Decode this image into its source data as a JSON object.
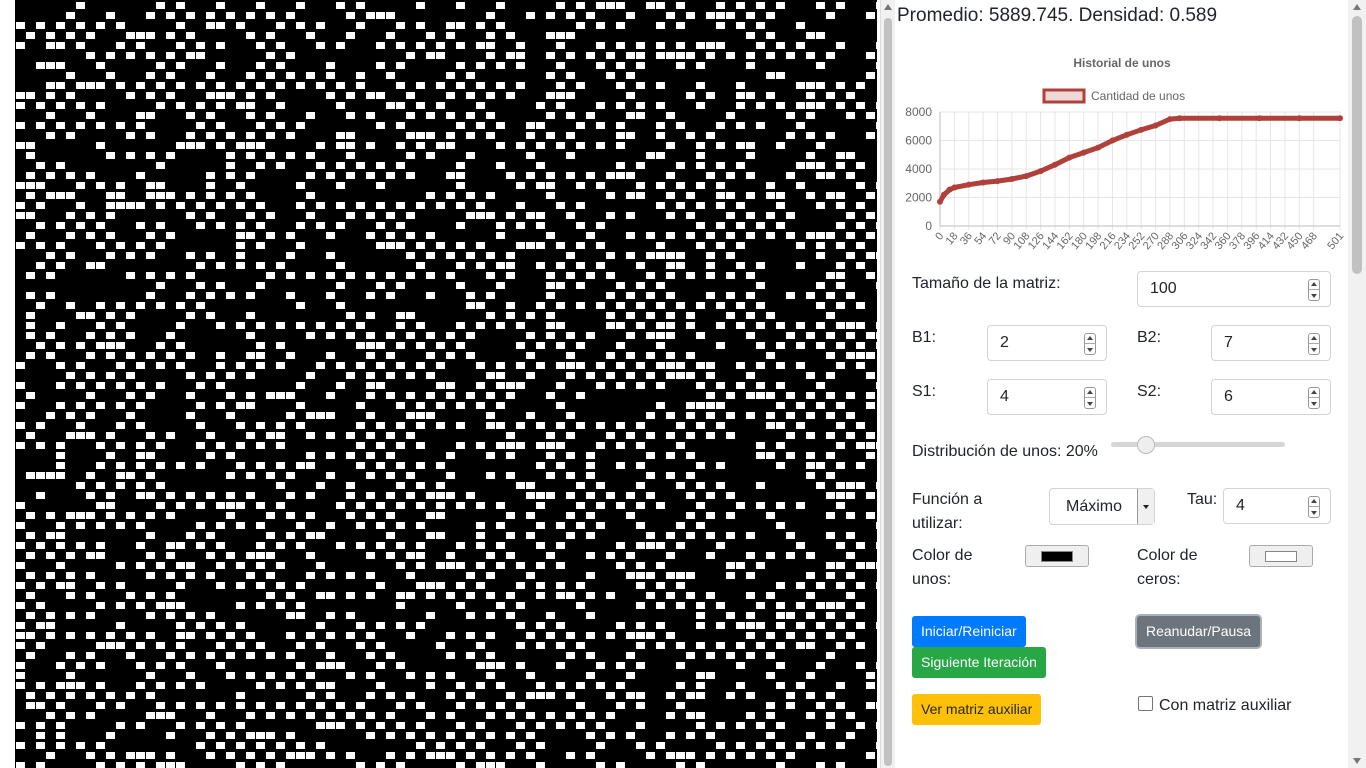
{
  "stats": {
    "text": "Promedio: 5889.745. Densidad: 0.589",
    "promedio": 5889.745,
    "densidad": 0.589
  },
  "grid": {
    "colors": {
      "unos": "#000000",
      "ceros": "#ffffff"
    }
  },
  "chart_data": {
    "type": "line",
    "title": "Historial de unos",
    "legend": "Cantidad de unos",
    "legend_position": "top",
    "color": "#b0403a",
    "ylim": [
      0,
      8000
    ],
    "yticks": [
      0,
      2000,
      4000,
      6000,
      8000
    ],
    "xticks": [
      "0",
      "18",
      "36",
      "54",
      "72",
      "90",
      "108",
      "126",
      "144",
      "162",
      "180",
      "198",
      "216",
      "234",
      "252",
      "270",
      "288",
      "306",
      "324",
      "342",
      "360",
      "378",
      "396",
      "414",
      "432",
      "450",
      "468",
      "501"
    ],
    "grid": true,
    "series": [
      {
        "name": "Cantidad de unos",
        "points": [
          [
            0,
            1700
          ],
          [
            5,
            2200
          ],
          [
            12,
            2550
          ],
          [
            18,
            2700
          ],
          [
            36,
            2900
          ],
          [
            54,
            3050
          ],
          [
            72,
            3150
          ],
          [
            90,
            3300
          ],
          [
            108,
            3500
          ],
          [
            126,
            3850
          ],
          [
            144,
            4300
          ],
          [
            162,
            4800
          ],
          [
            180,
            5150
          ],
          [
            198,
            5500
          ],
          [
            216,
            6000
          ],
          [
            234,
            6400
          ],
          [
            252,
            6750
          ],
          [
            270,
            7050
          ],
          [
            288,
            7500
          ],
          [
            300,
            7560
          ],
          [
            350,
            7560
          ],
          [
            400,
            7560
          ],
          [
            450,
            7560
          ],
          [
            501,
            7560
          ]
        ]
      }
    ]
  },
  "form": {
    "size_label": "Tamaño de la matriz:",
    "size_value": "100",
    "b1_label": "B1:",
    "b1_value": "2",
    "b2_label": "B2:",
    "b2_value": "7",
    "s1_label": "S1:",
    "s1_value": "4",
    "s2_label": "S2:",
    "s2_value": "6",
    "dist_label": "Distribución de unos: 20%",
    "dist_value": 0.2,
    "func_label_1": "Función a",
    "func_label_2": "utilizar:",
    "func_value": "Máximo",
    "tau_label": "Tau:",
    "tau_value": "4",
    "color_unos_1": "Color de",
    "color_unos_2": "unos:",
    "color_unos_value": "#000000",
    "color_ceros_1": "Color de",
    "color_ceros_2": "ceros:",
    "color_ceros_value": "#ffffff"
  },
  "buttons": {
    "start": {
      "label": "Iniciar/Reiniciar",
      "color": "#007bff"
    },
    "pause": {
      "label": "Reanudar/Pausa",
      "color": "#6c757d"
    },
    "next": {
      "label": "Siguiente Iteración",
      "color": "#28a745"
    },
    "aux": {
      "label": "Ver matriz auxiliar",
      "color": "#ffc107"
    }
  },
  "aux_checkbox": {
    "label": "Con matriz auxiliar",
    "checked": false
  }
}
